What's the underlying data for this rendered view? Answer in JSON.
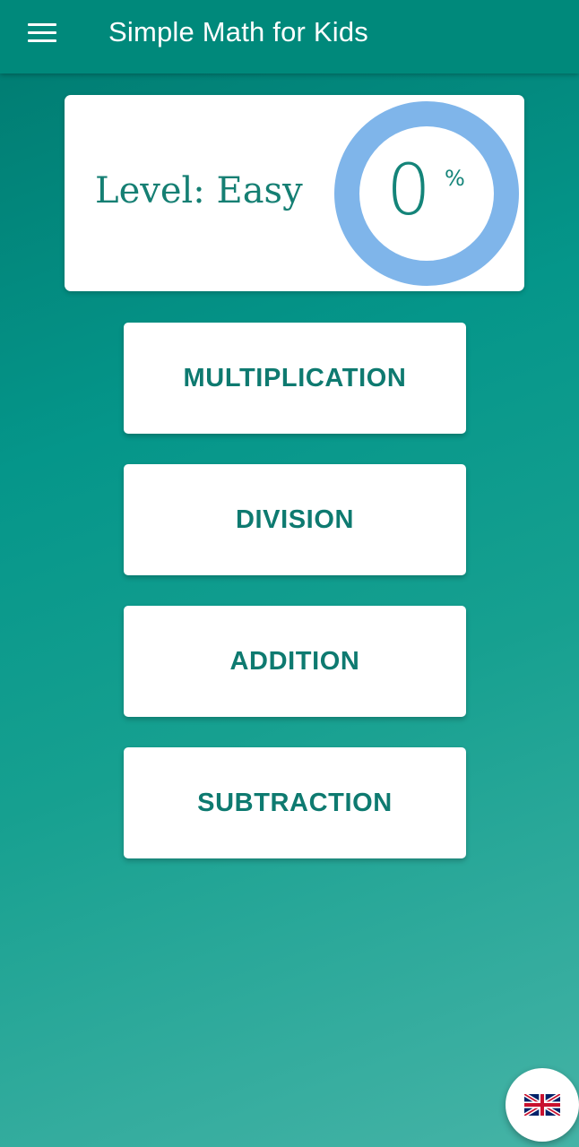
{
  "app_bar": {
    "title": "Simple Math for Kids",
    "menu_icon": "hamburger-menu-icon",
    "background_color": "#00897b"
  },
  "level_card": {
    "level_label": "Level: Easy",
    "progress_value": "0",
    "progress_unit": "%",
    "progress_fraction": 0,
    "ring_color": "#7fb5ea"
  },
  "operations": [
    {
      "label": "MULTIPLICATION"
    },
    {
      "label": "DIVISION"
    },
    {
      "label": "ADDITION"
    },
    {
      "label": "SUBTRACTION"
    }
  ],
  "language_fab": {
    "icon": "uk-flag-icon"
  },
  "colors": {
    "accent": "#00897b",
    "button_text": "#0e7a70"
  }
}
